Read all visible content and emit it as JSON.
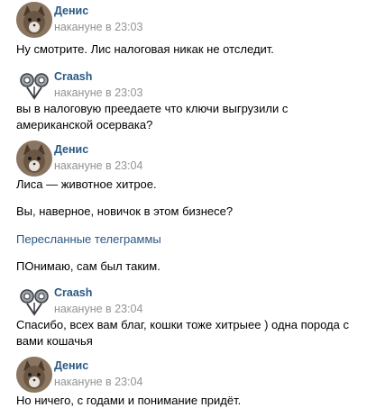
{
  "messages": [
    {
      "author": "Денис",
      "time": "накануне в 23:03",
      "text": "Ну смотрите. Лис налоговая никак не отследит."
    },
    {
      "author": "Craash",
      "time": "накануне в 23:03",
      "text": "вы в налоговую преедаете что ключи выгрузили с американской осервака?"
    },
    {
      "author": "Денис",
      "time": "накануне в 23:04",
      "text1": "Лиса — животное хитрое.",
      "text2": "Вы, наверное, новичок в этом бизнесе?",
      "forwarded_label": "Пересланные телеграммы",
      "text3": "ПОнимаю, сам был таким."
    },
    {
      "author": "Craash",
      "time": "накануне в 23:04",
      "text": "Спасибо, всех вам благ, кошки тоже хитрыее ) одна порода с вами кошачья"
    },
    {
      "author": "Денис",
      "time": "накануне в 23:04",
      "text": "Но ничего, с годами и понимание придёт."
    }
  ],
  "colors": {
    "author_link": "#2a5885",
    "timestamp": "#939393",
    "text": "#000000"
  },
  "icons": {
    "denis_avatar": "cat-avatar-icon",
    "craash_avatar": "robot-avatar-icon"
  }
}
